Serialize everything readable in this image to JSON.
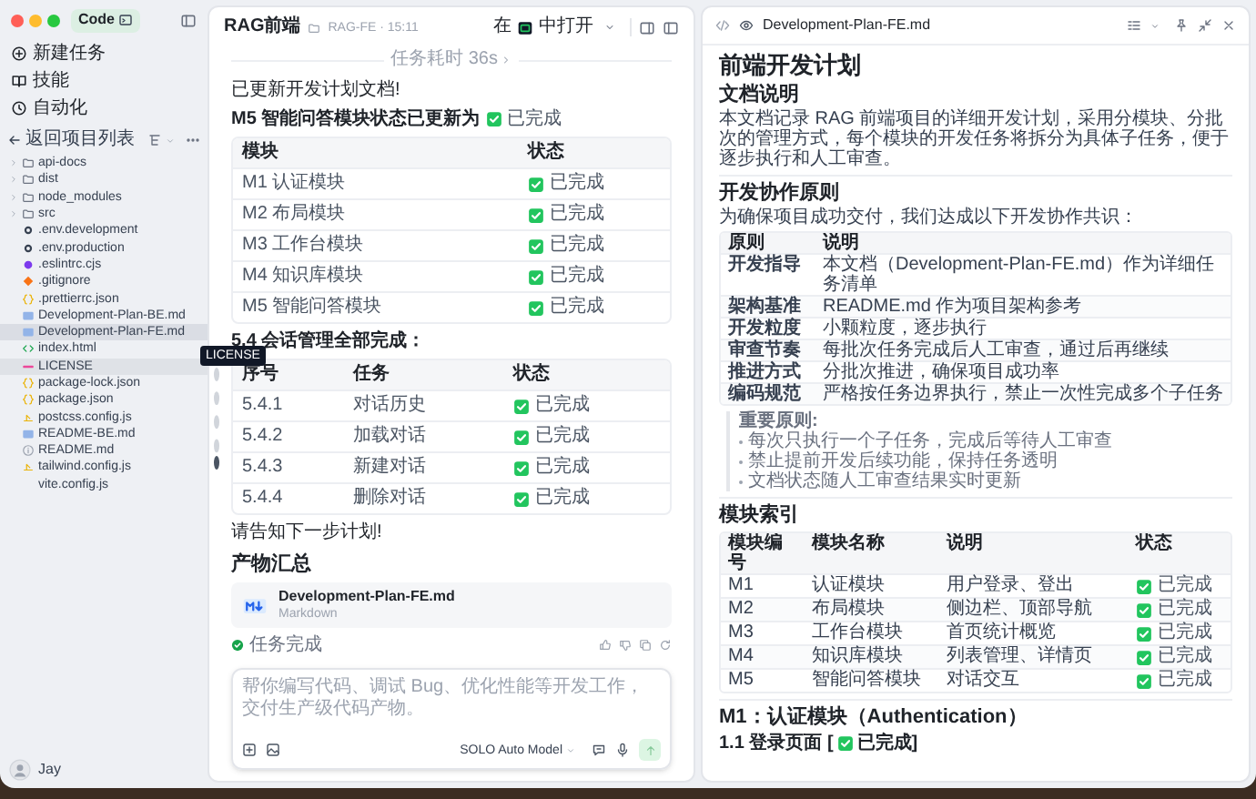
{
  "sidebar": {
    "app_badge": "Code",
    "nav": [
      {
        "label": "新建任务",
        "kind": "new"
      },
      {
        "label": "技能",
        "kind": "skills"
      },
      {
        "label": "自动化",
        "kind": "automation"
      }
    ],
    "back_label": "返回项目列表",
    "files": [
      {
        "name": "api-docs",
        "kind": "folder",
        "selected": false,
        "hovered": false
      },
      {
        "name": "dist",
        "kind": "folder",
        "selected": false,
        "hovered": false
      },
      {
        "name": "node_modules",
        "kind": "folder",
        "selected": false,
        "hovered": false
      },
      {
        "name": "src",
        "kind": "folder",
        "selected": false,
        "hovered": false
      },
      {
        "name": ".env.development",
        "kind": "config",
        "selected": false,
        "hovered": false
      },
      {
        "name": ".env.production",
        "kind": "config",
        "selected": false,
        "hovered": false
      },
      {
        "name": ".eslintrc.cjs",
        "kind": "eslint",
        "selected": false,
        "hovered": false
      },
      {
        "name": ".gitignore",
        "kind": "git",
        "selected": false,
        "hovered": false
      },
      {
        "name": ".prettierrc.json",
        "kind": "json",
        "selected": false,
        "hovered": false
      },
      {
        "name": "Development-Plan-BE.md",
        "kind": "markdown",
        "selected": false,
        "hovered": false
      },
      {
        "name": "Development-Plan-FE.md",
        "kind": "markdown",
        "selected": true,
        "hovered": false
      },
      {
        "name": "index.html",
        "kind": "html",
        "selected": false,
        "hovered": false
      },
      {
        "name": "LICENSE",
        "kind": "license",
        "selected": false,
        "hovered": true
      },
      {
        "name": "package-lock.json",
        "kind": "json",
        "selected": false,
        "hovered": false
      },
      {
        "name": "package.json",
        "kind": "json",
        "selected": false,
        "hovered": false
      },
      {
        "name": "postcss.config.js",
        "kind": "js",
        "selected": false,
        "hovered": false
      },
      {
        "name": "README-BE.md",
        "kind": "markdown",
        "selected": false,
        "hovered": false
      },
      {
        "name": "README.md",
        "kind": "info",
        "selected": false,
        "hovered": false
      },
      {
        "name": "tailwind.config.js",
        "kind": "js",
        "selected": false,
        "hovered": false
      },
      {
        "name": "vite.config.js",
        "kind": "plain",
        "selected": false,
        "hovered": false
      }
    ],
    "tooltip": "LICENSE",
    "user": "Jay"
  },
  "task": {
    "title": "RAG前端",
    "path": "RAG-FE · 15:11",
    "open_in_before": "在",
    "open_in_after": "中打开",
    "duration": "任务耗时 36s",
    "intro": "已更新开发计划文档!",
    "update_text": "M5 智能问答模块状态已更新为",
    "update_status": {
      "label": "已完成",
      "done": true
    },
    "module_table": {
      "columns": [
        "模块",
        "状态"
      ],
      "rows": [
        {
          "module": "M1 认证模块",
          "status": "已完成",
          "done": true
        },
        {
          "module": "M2 布局模块",
          "status": "已完成",
          "done": true
        },
        {
          "module": "M3 工作台模块",
          "status": "已完成",
          "done": true
        },
        {
          "module": "M4 知识库模块",
          "status": "已完成",
          "done": true
        },
        {
          "module": "M5 智能问答模块",
          "status": "已完成",
          "done": true
        }
      ]
    },
    "session_heading": "5.4 会话管理全部完成：",
    "session_table": {
      "columns": [
        "序号",
        "任务",
        "状态"
      ],
      "rows": [
        {
          "id": "5.4.1",
          "task": "对话历史",
          "status": "已完成",
          "done": true
        },
        {
          "id": "5.4.2",
          "task": "加载对话",
          "status": "已完成",
          "done": true
        },
        {
          "id": "5.4.3",
          "task": "新建对话",
          "status": "已完成",
          "done": true
        },
        {
          "id": "5.4.4",
          "task": "删除对话",
          "status": "已完成",
          "done": true
        }
      ]
    },
    "closing": "请告知下一步计划!",
    "artifacts_heading": "产物汇总",
    "artifact": {
      "name": "Development-Plan-FE.md",
      "type": "Markdown"
    },
    "task_status": "任务完成"
  },
  "composer": {
    "placeholder": "帮你编写代码、调试 Bug、优化性能等开发工作，交付生产级代码产物。",
    "model": "SOLO Auto Model"
  },
  "document": {
    "filename": "Development-Plan-FE.md",
    "title": "前端开发计划",
    "about_heading": "文档说明",
    "about_text": "本文档记录 RAG 前端项目的详细开发计划，采用分模块、分批次的管理方式，每个模块的开发任务将拆分为具体子任务，便于逐步执行和人工审查。",
    "principles_heading": "开发协作原则",
    "principles_intro": "为确保项目成功交付，我们达成以下开发协作共识：",
    "principles_table": {
      "columns": [
        "原则",
        "说明"
      ],
      "rows": [
        [
          "开发指导",
          "本文档（Development-Plan-FE.md）作为详细任务清单"
        ],
        [
          "架构基准",
          "README.md 作为项目架构参考"
        ],
        [
          "开发粒度",
          "小颗粒度，逐步执行"
        ],
        [
          "审查节奏",
          "每批次任务完成后人工审查，通过后再继续"
        ],
        [
          "推进方式",
          "分批次推进，确保项目成功率"
        ],
        [
          "编码规范",
          "严格按任务边界执行，禁止一次性完成多个子任务"
        ]
      ]
    },
    "note_title": "重要原则:",
    "note_items": [
      "每次只执行一个子任务，完成后等待人工审查",
      "禁止提前开发后续功能，保持任务透明",
      "文档状态随人工审查结果实时更新"
    ],
    "index_heading": "模块索引",
    "index_table": {
      "columns": [
        "模块编号",
        "模块名称",
        "说明",
        "状态"
      ],
      "rows": [
        {
          "cells": [
            "M1",
            "认证模块",
            "用户登录、登出"
          ],
          "status": "已完成",
          "done": true
        },
        {
          "cells": [
            "M2",
            "布局模块",
            "侧边栏、顶部导航"
          ],
          "status": "已完成",
          "done": true
        },
        {
          "cells": [
            "M3",
            "工作台模块",
            "首页统计概览"
          ],
          "status": "已完成",
          "done": true
        },
        {
          "cells": [
            "M4",
            "知识库模块",
            "列表管理、详情页"
          ],
          "status": "已完成",
          "done": true
        },
        {
          "cells": [
            "M5",
            "智能问答模块",
            "对话交互"
          ],
          "status": "已完成",
          "done": true
        }
      ]
    },
    "m1_heading": "M1：认证模块（Authentication）",
    "subsection": {
      "label": "1.1 登录页面 [",
      "status": "已完成]",
      "done": true
    }
  }
}
